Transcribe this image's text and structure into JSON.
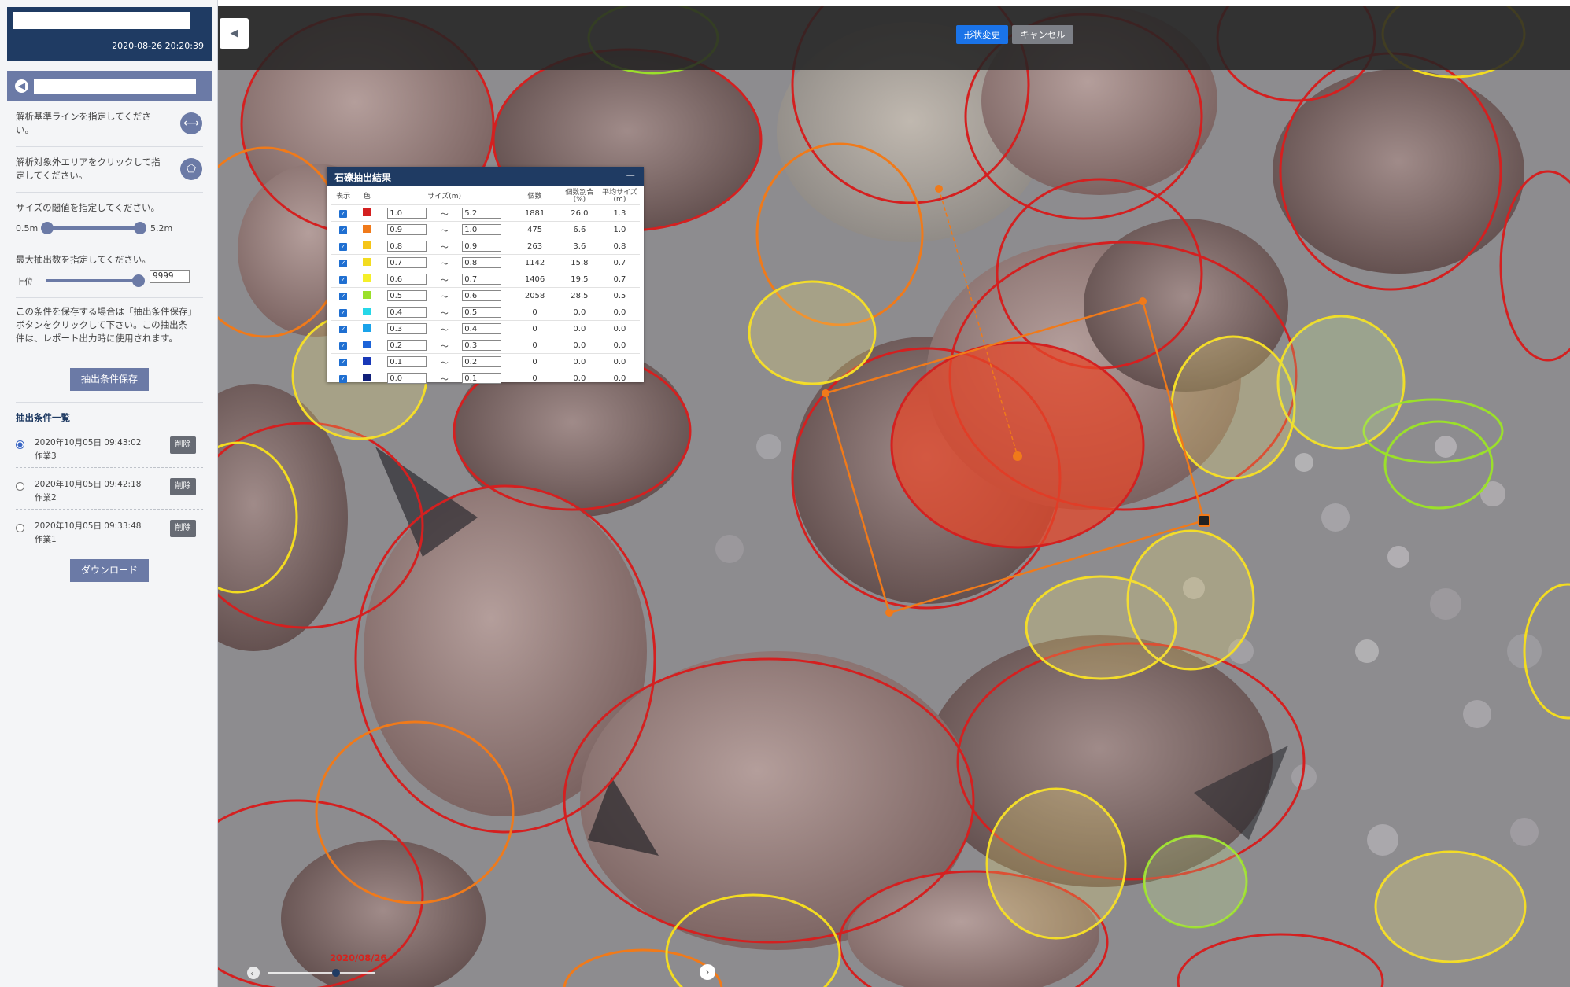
{
  "header": {
    "timestamp": "2020-08-26 20:20:39"
  },
  "instructions": {
    "baseline_text": "解析基準ラインを指定してください。",
    "exclude_text": "解析対象外エリアをクリックして指定してください。",
    "size_text": "サイズの閾値を指定してください。",
    "size_min": "0.5m",
    "size_max": "5.2m",
    "max_text": "最大抽出数を指定してください。",
    "max_prefix": "上位",
    "max_value": "9999",
    "save_note": "この条件を保存する場合は「抽出条件保存」ボタンをクリックして下さい。この抽出条件は、レポート出力時に使用されます。",
    "save_button": "抽出条件保存"
  },
  "saved_conditions": {
    "title": "抽出条件一覧",
    "items": [
      {
        "date": "2020年10月05日 09:43:02",
        "name": "作業3",
        "selected": true,
        "delete_label": "削除"
      },
      {
        "date": "2020年10月05日 09:42:18",
        "name": "作業2",
        "selected": false,
        "delete_label": "削除"
      },
      {
        "date": "2020年10月05日 09:33:48",
        "name": "作業1",
        "selected": false,
        "delete_label": "削除"
      }
    ],
    "download_button": "ダウンロード"
  },
  "toolbar": {
    "shape_change": "形状変更",
    "cancel": "キャンセル"
  },
  "result_panel": {
    "title": "石礫抽出結果",
    "minimize": "−",
    "columns": {
      "show": "表示",
      "color": "色",
      "size": "サイズ(m)",
      "count": "個数",
      "ratio": "個数割合 (%)",
      "avg": "平均サイズ (m)"
    },
    "tilde": "～",
    "rows": [
      {
        "color": "#d42020",
        "from": "1.0",
        "to": "5.2",
        "count": "1881",
        "ratio": "26.0",
        "avg": "1.3"
      },
      {
        "color": "#f07a1a",
        "from": "0.9",
        "to": "1.0",
        "count": "475",
        "ratio": "6.6",
        "avg": "1.0"
      },
      {
        "color": "#f5c518",
        "from": "0.8",
        "to": "0.9",
        "count": "263",
        "ratio": "3.6",
        "avg": "0.8"
      },
      {
        "color": "#f3dc20",
        "from": "0.7",
        "to": "0.8",
        "count": "1142",
        "ratio": "15.8",
        "avg": "0.7"
      },
      {
        "color": "#f5ef2a",
        "from": "0.6",
        "to": "0.7",
        "count": "1406",
        "ratio": "19.5",
        "avg": "0.7"
      },
      {
        "color": "#9be02a",
        "from": "0.5",
        "to": "0.6",
        "count": "2058",
        "ratio": "28.5",
        "avg": "0.5"
      },
      {
        "color": "#26d7e8",
        "from": "0.4",
        "to": "0.5",
        "count": "0",
        "ratio": "0.0",
        "avg": "0.0"
      },
      {
        "color": "#1aa3ea",
        "from": "0.3",
        "to": "0.4",
        "count": "0",
        "ratio": "0.0",
        "avg": "0.0"
      },
      {
        "color": "#1c63d8",
        "from": "0.2",
        "to": "0.3",
        "count": "0",
        "ratio": "0.0",
        "avg": "0.0"
      },
      {
        "color": "#1838b8",
        "from": "0.1",
        "to": "0.2",
        "count": "0",
        "ratio": "0.0",
        "avg": "0.0"
      },
      {
        "color": "#10207a",
        "from": "0.0",
        "to": "0.1",
        "count": "0",
        "ratio": "0.0",
        "avg": "0.0"
      }
    ]
  },
  "timeline": {
    "date": "2020/08/26"
  }
}
